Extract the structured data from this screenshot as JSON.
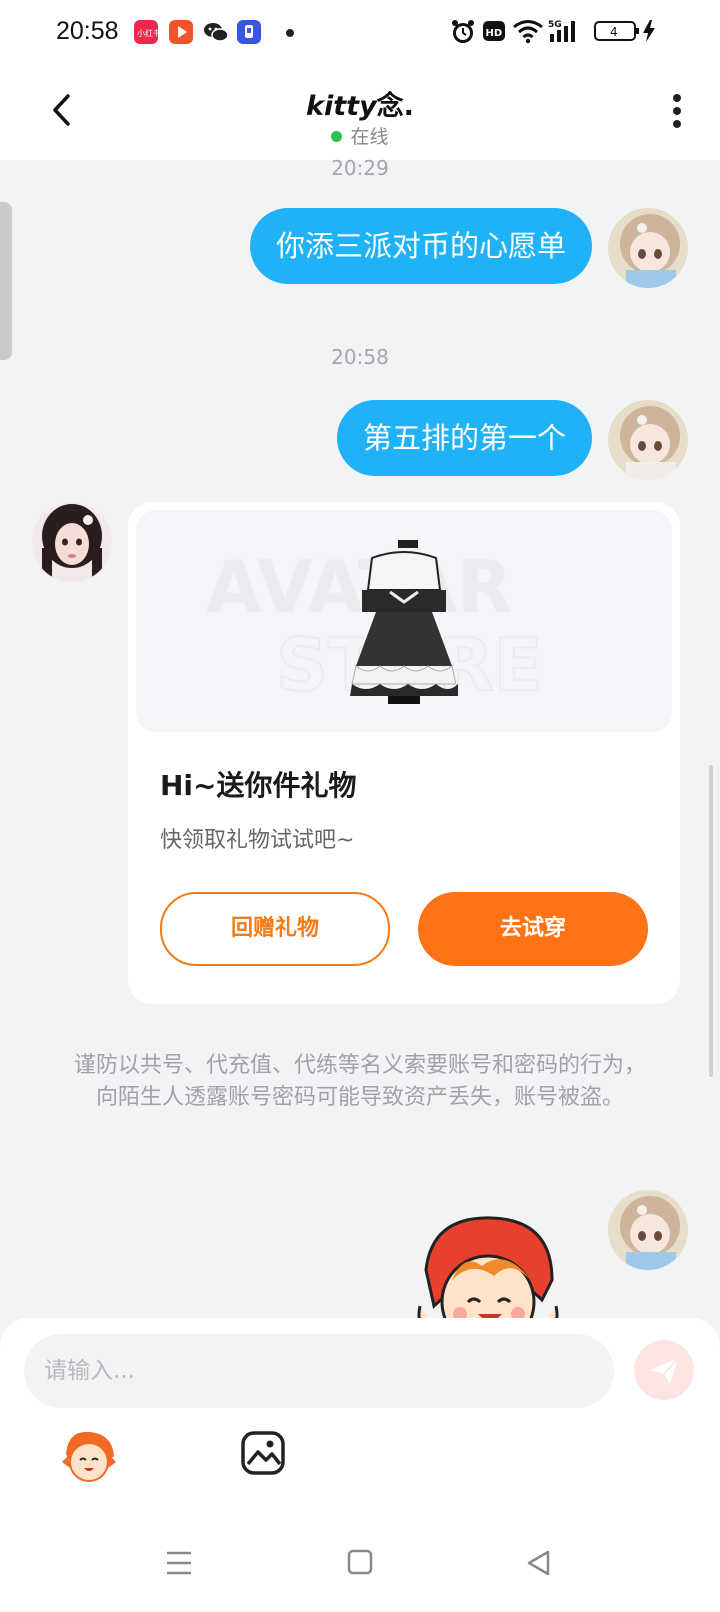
{
  "status_bar": {
    "time": "20:58",
    "apps": [
      "xiaohongshu-icon",
      "video-player-icon",
      "wechat-icon",
      "badge-app-icon"
    ],
    "battery": "4",
    "indicators": [
      "alarm-icon",
      "hd-icon",
      "wifi-icon",
      "5g-signal-icon",
      "battery-icon",
      "charging-icon"
    ]
  },
  "header": {
    "title_italic": "kitty",
    "title_rest": "念.",
    "status": "在线",
    "status_color": "#2ec34a"
  },
  "messages": [
    {
      "type": "timestamp",
      "text": "20:29"
    },
    {
      "type": "outgoing",
      "text": "你添三派对币的心愿单"
    },
    {
      "type": "timestamp",
      "text": "20:58"
    },
    {
      "type": "outgoing",
      "text": "第五排的第一个"
    }
  ],
  "gift_card": {
    "watermark_line1": "AVATAR",
    "watermark_line2": "STORE",
    "title": "Hi~送你件礼物",
    "subtitle": "快领取礼物试试吧~",
    "return_gift_label": "回赠礼物",
    "try_on_label": "去试穿",
    "accent": "#fd7316"
  },
  "notice": "谨防以共号、代充值、代练等名义索要账号和密码的行为，向陌生人透露账号密码可能导致资产丢失，账号被盗。",
  "input": {
    "placeholder": "请输入..."
  },
  "colors": {
    "bubble": "#1fb2f6",
    "background": "#f2f3f5"
  }
}
